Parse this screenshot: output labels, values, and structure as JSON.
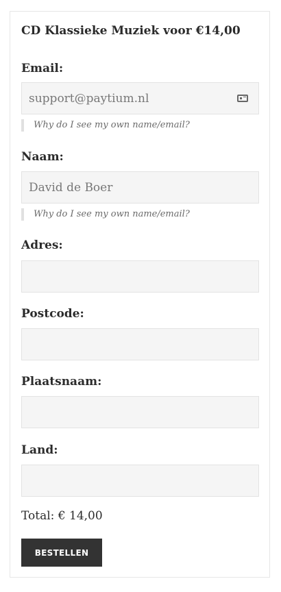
{
  "form": {
    "title": "CD Klassieke Muziek voor €14,00",
    "email": {
      "label": "Email:",
      "value": "support@paytium.nl",
      "hint": "Why do I see my own name/email?",
      "icon": "contact-card-icon"
    },
    "naam": {
      "label": "Naam:",
      "value": "David de Boer",
      "hint": "Why do I see my own name/email?"
    },
    "adres": {
      "label": "Adres:",
      "value": ""
    },
    "postcode": {
      "label": "Postcode:",
      "value": ""
    },
    "plaatsnaam": {
      "label": "Plaatsnaam:",
      "value": ""
    },
    "land": {
      "label": "Land:",
      "value": ""
    },
    "total": "Total: € 14,00",
    "submit_label": "BESTELLEN"
  }
}
